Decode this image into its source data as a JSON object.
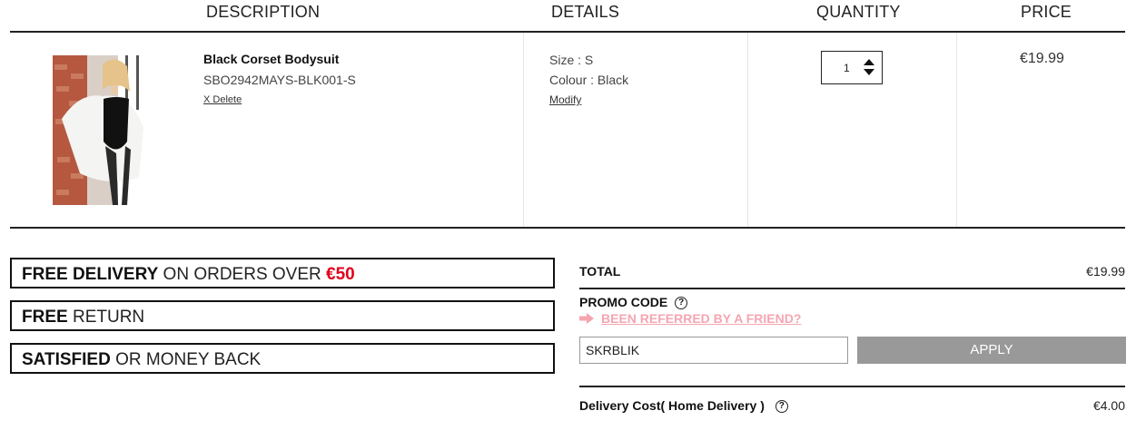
{
  "table": {
    "headers": {
      "description": "DESCRIPTION",
      "details": "DETAILS",
      "quantity": "QUANTITY",
      "price": "PRICE"
    }
  },
  "item": {
    "name": "Black Corset Bodysuit",
    "sku": "SBO2942MAYS-BLK001-S",
    "delete_label": "X Delete",
    "size": "Size : S",
    "colour": "Colour : Black",
    "modify_label": "Modify",
    "quantity": "1",
    "price": "€19.99"
  },
  "perks": {
    "free_delivery_bold": "FREE DELIVERY",
    "free_delivery_text": " ON ORDERS OVER ",
    "free_delivery_amount": "€50",
    "free_return_bold": "FREE",
    "free_return_text": " RETURN",
    "satisfied_bold": "SATISFIED",
    "satisfied_text": " OR MONEY BACK"
  },
  "summary": {
    "total_label": "TOTAL",
    "total_value": "€19.99",
    "promo_label": "PROMO CODE",
    "referred_label": "BEEN REFERRED BY A FRIEND?",
    "promo_value": "SKRBLIK",
    "apply_label": "APPLY",
    "delivery_label": "Delivery Cost( Home Delivery )",
    "delivery_value": "€4.00"
  },
  "icons": {
    "help": "question-circle-icon",
    "arrow": "right-arrow-icon",
    "qty_up": "caret-up-icon",
    "qty_down": "caret-down-icon"
  },
  "colors": {
    "accent_red": "#e0001b",
    "referred_pink": "#f4a6b1",
    "apply_gray": "#999999"
  }
}
